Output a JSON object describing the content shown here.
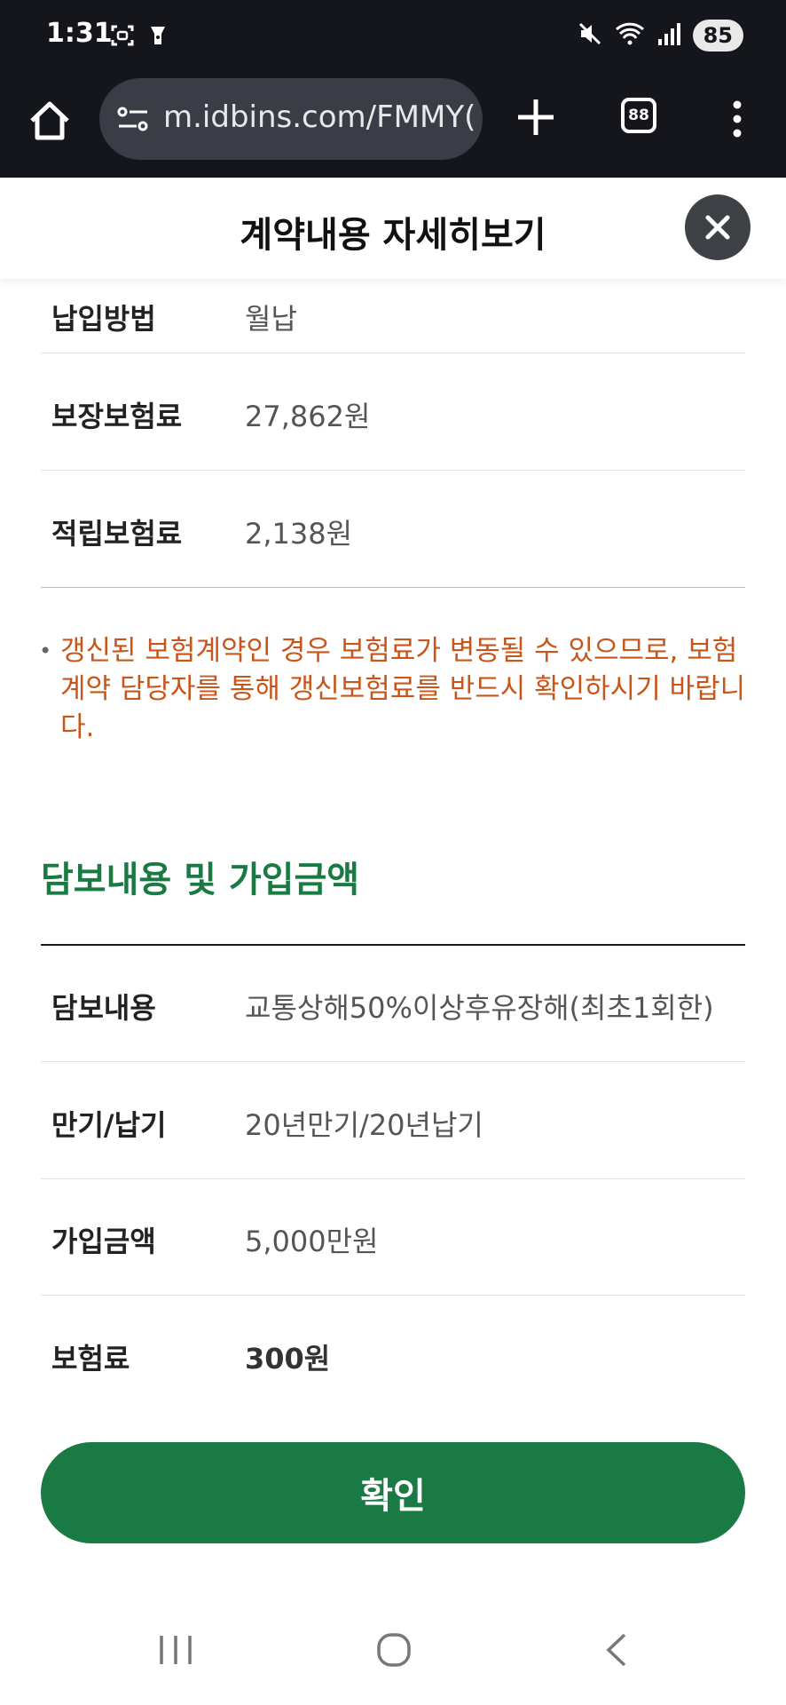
{
  "status_bar": {
    "time": "1:31",
    "icons": [
      "screenshot-icon",
      "flashlight-icon",
      "mute-icon",
      "wifi-icon",
      "signal-icon"
    ],
    "battery": "85"
  },
  "browser": {
    "url": "m.idbins.com/FMMY(",
    "tab_count": "88",
    "icons": [
      "home-icon",
      "site-settings-icon",
      "new-tab-icon",
      "tabs-icon",
      "more-menu-icon"
    ]
  },
  "modal": {
    "title": "계약내용 자세히보기",
    "close_icon": "close-icon"
  },
  "payment_rows": [
    {
      "label": "납입방법",
      "value": "월납"
    },
    {
      "label": "보장보험료",
      "value": "27,862원"
    },
    {
      "label": "적립보험료",
      "value": "2,138원"
    }
  ],
  "notice": {
    "bullet": "•",
    "text": "갱신된 보험계약인 경우 보험료가 변동될 수 있으므로, 보험계약 담당자를 통해 갱신보험료를 반드시 확인하시기 바랍니다."
  },
  "coverage_section": {
    "title": "담보내용 및 가입금액",
    "rows": [
      {
        "label": "담보내용",
        "value": "교통상해50%이상후유장해(최초1회한)"
      },
      {
        "label": "만기/납기",
        "value": "20년만기/20년납기"
      },
      {
        "label": "가입금액",
        "value": "5,000만원"
      },
      {
        "label": "보험료",
        "value": "300원"
      }
    ]
  },
  "confirm_button": "확인",
  "colors": {
    "accent_green": "#1a7a44",
    "notice_orange": "#c8561a",
    "status_bar_bg": "#15161b",
    "url_pill_bg": "#3a3d46",
    "close_button_bg": "#3e4247"
  },
  "nav_bar": {
    "icons": [
      "recent-apps-icon",
      "home-circle-icon",
      "back-icon"
    ]
  }
}
